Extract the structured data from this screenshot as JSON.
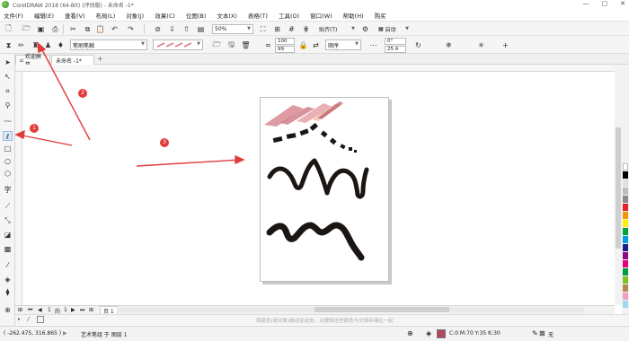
{
  "window": {
    "title": "CorelDRAW 2018 (64-Bit) (评估版) - 未命名 -1*",
    "controls": [
      "—",
      "▢",
      "✕"
    ]
  },
  "menu": [
    "文件(F)",
    "编辑(E)",
    "查看(V)",
    "布局(L)",
    "对象(J)",
    "效果(C)",
    "位图(B)",
    "文本(X)",
    "表格(T)",
    "工具(O)",
    "窗口(W)",
    "帮助(H)",
    "购买"
  ],
  "toolbar": {
    "zoom_value": "50%",
    "snap_label": "贴齐(T)",
    "launch_label": "启动"
  },
  "propbar": {
    "brush_type": "笔刷笔触",
    "smoothing_value": "100",
    "width_value": "99",
    "order_label": "顺序",
    "angle_value": "0°",
    "size_value": "25.4"
  },
  "tabs": {
    "welcome": "欢迎屏幕",
    "document": "未命名 -1*",
    "add": "+"
  },
  "pagenav": {
    "current": "1",
    "of": "的",
    "total": "1",
    "page_label": "页 1"
  },
  "docpalette_hint": "将颜色(或对象)拖动至此处，以便将这些颜色与文档存储在一起",
  "status": {
    "coords": "( -262.475, 316.865 )",
    "selection": "艺术笔组 于 图层 1",
    "color_readout": "C:0 M:70 Y:35 K:30",
    "outline": "无"
  },
  "annotations": [
    "1",
    "2",
    "3"
  ],
  "colors": {
    "accent_red": "#e23b3b",
    "stroke_black": "#1b1614",
    "selected_fill": "#b34a5b"
  },
  "palette": [
    "#ffffff",
    "#000000",
    "#e0e0e0",
    "#bdbdbd",
    "#8c8c8c",
    "#e62128",
    "#f39800",
    "#fff100",
    "#00a23a",
    "#00a0e9",
    "#1d2088",
    "#920783",
    "#e4007f",
    "#009944",
    "#7fbe26",
    "#b28850",
    "#f19ec2",
    "#a0d8ef"
  ]
}
